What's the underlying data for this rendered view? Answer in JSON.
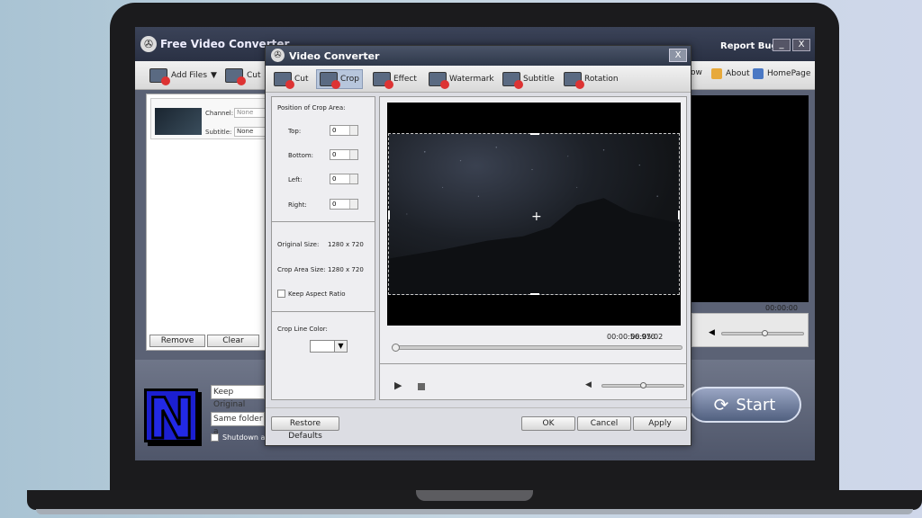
{
  "main": {
    "title": "Free Video Converter",
    "report_bugs": "Report Bugs",
    "minimize": "_",
    "close": "X",
    "toolbar": {
      "add_files": "Add Files",
      "cut": "Cut",
      "ow_partial": "ow",
      "about": "About",
      "homepage": "HomePage"
    },
    "file_item": {
      "channel_label": "Channel:",
      "channel_value": "None",
      "subtitle_label": "Subtitle:",
      "subtitle_value": "None"
    },
    "remove": "Remove",
    "clear": "Clear",
    "right_time": "00:00:00",
    "keep_original": "Keep Original",
    "same_folder": "Same folder a",
    "shutdown": "Shutdown a",
    "start": "Start"
  },
  "dialog": {
    "title": "Video Converter",
    "close": "X",
    "tabs": [
      {
        "label": "Cut",
        "icon": "film-cut-icon",
        "color": "#d33"
      },
      {
        "label": "Crop",
        "icon": "film-crop-icon",
        "color": "#d33"
      },
      {
        "label": "Effect",
        "icon": "film-effect-icon",
        "color": "#d33"
      },
      {
        "label": "Watermark",
        "icon": "film-watermark-icon",
        "color": "#d33"
      },
      {
        "label": "Subtitle",
        "icon": "film-subtitle-icon",
        "color": "#d33"
      },
      {
        "label": "Rotation",
        "icon": "film-rotation-icon",
        "color": "#d33"
      }
    ],
    "active_tab": "Crop",
    "crop": {
      "position_heading": "Position of Crop Area:",
      "top_label": "Top:",
      "top_value": "0",
      "bottom_label": "Bottom:",
      "bottom_value": "0",
      "left_label": "Left:",
      "left_value": "0",
      "right_label": "Right:",
      "right_value": "0",
      "original_size_label": "Original Size:",
      "original_size_value": "1280 x 720",
      "crop_area_size_label": "Crop Area Size:",
      "crop_area_size_value": "1280 x 720",
      "keep_aspect_ratio": "Keep Aspect Ratio",
      "crop_line_color": "Crop Line Color:"
    },
    "time": "00:00:56.970",
    "total_time": "00:05:02",
    "restore_defaults": "Restore Defaults",
    "ok": "OK",
    "cancel": "Cancel",
    "apply": "Apply"
  }
}
